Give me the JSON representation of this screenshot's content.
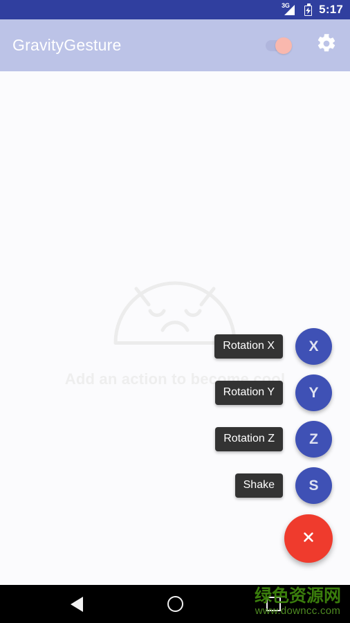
{
  "status_bar": {
    "network_label": "3G",
    "signal_icon": "signal-bars-icon",
    "battery_icon": "battery-charging-icon",
    "time": "5:17",
    "background_color": "#303f9f"
  },
  "app_bar": {
    "title": "GravityGesture",
    "background_color": "#bcc3e7",
    "title_color": "#ffffff",
    "switch": {
      "name": "service-toggle-switch",
      "state": "on",
      "thumb_color": "#f9b8ae",
      "track_color": "#b0b6dd"
    },
    "settings_icon": "gear-icon"
  },
  "content": {
    "empty_state": {
      "illustration": "sad-android-face-icon",
      "message": "Add an action to become cool",
      "text_color": "#eeeeee"
    },
    "background_color": "#fbfbfd"
  },
  "fab_menu": {
    "expanded": true,
    "mini_fab_color": "#3f51b5",
    "label_background": "#333333",
    "main_fab": {
      "name": "close-speed-dial-fab",
      "icon": "close-x-icon",
      "color": "#ef3b2d"
    },
    "actions": [
      {
        "label": "Rotation X",
        "initial": "X",
        "name": "fab-action-rotation-x"
      },
      {
        "label": "Rotation Y",
        "initial": "Y",
        "name": "fab-action-rotation-y"
      },
      {
        "label": "Rotation Z",
        "initial": "Z",
        "name": "fab-action-rotation-z"
      },
      {
        "label": "Shake",
        "initial": "S",
        "name": "fab-action-shake"
      }
    ]
  },
  "nav_bar": {
    "background_color": "#000000",
    "buttons": [
      {
        "name": "nav-back-button",
        "icon": "back-triangle-icon"
      },
      {
        "name": "nav-home-button",
        "icon": "home-circle-icon"
      },
      {
        "name": "nav-recents-button",
        "icon": "recents-square-icon"
      }
    ]
  },
  "watermark": {
    "chinese": "绿色资源网",
    "url": "www.downcc.com",
    "color": "#3a7d0c"
  }
}
